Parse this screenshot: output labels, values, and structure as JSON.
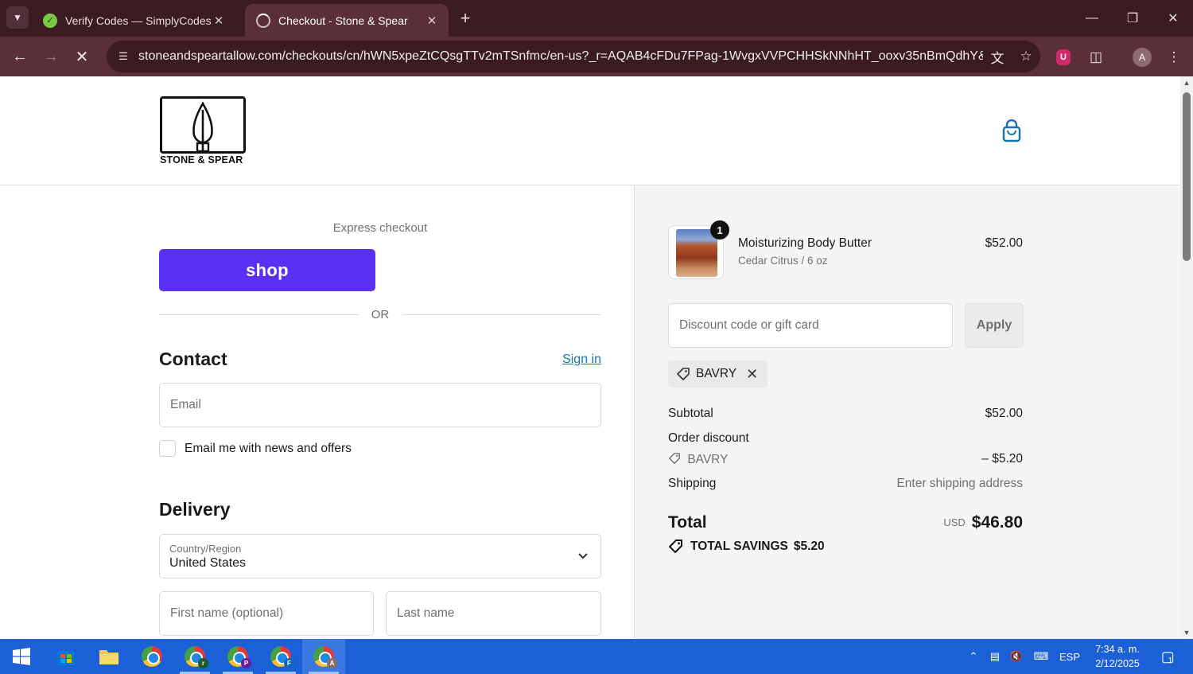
{
  "browser": {
    "tabs": [
      {
        "title": "Verify Codes — SimplyCodes",
        "active": false
      },
      {
        "title": "Checkout - Stone & Spear",
        "active": true
      }
    ],
    "url": "stoneandspeartallow.com/checkouts/cn/hWN5xpeZtCQsgTTv2mTSnfmc/en-us?_r=AQAB4cFDu7FPag-1WvgxVVPCHHSkNNhHT_ooxv35nBmQdhY&auto...",
    "profile_initial": "A",
    "extension_letter": "U"
  },
  "store": {
    "brand": "STONE & SPEAR"
  },
  "checkout": {
    "express_label": "Express checkout",
    "shop_pay_label": "shop",
    "or_label": "OR",
    "contact_title": "Contact",
    "sign_in_label": "Sign in",
    "email_placeholder": "Email",
    "newsletter_label": "Email me with news and offers",
    "delivery_title": "Delivery",
    "country_label": "Country/Region",
    "country_value": "United States",
    "first_name_placeholder": "First name (optional)",
    "last_name_placeholder": "Last name"
  },
  "summary": {
    "item": {
      "quantity": "1",
      "name": "Moisturizing Body Butter",
      "variant": "Cedar Citrus / 6 oz",
      "price": "$52.00"
    },
    "discount_placeholder": "Discount code or gift card",
    "apply_label": "Apply",
    "applied_code": "BAVRY",
    "subtotal_label": "Subtotal",
    "subtotal_value": "$52.00",
    "order_discount_label": "Order discount",
    "discount_code": "BAVRY",
    "discount_value": "– $5.20",
    "shipping_label": "Shipping",
    "shipping_value": "Enter shipping address",
    "total_label": "Total",
    "currency": "USD",
    "total_value": "$46.80",
    "savings_label": "TOTAL SAVINGS",
    "savings_value": "$5.20"
  },
  "taskbar": {
    "language": "ESP",
    "time": "7:34 a. m.",
    "date": "2/12/2025",
    "notification_count": "1",
    "chrome_profiles": [
      "r",
      "P",
      "F",
      "A"
    ]
  },
  "colors": {
    "shop_pay": "#5a31f4",
    "link": "#1773b0",
    "browser_frame": "#3b1b22",
    "taskbar": "#1b60d6"
  }
}
